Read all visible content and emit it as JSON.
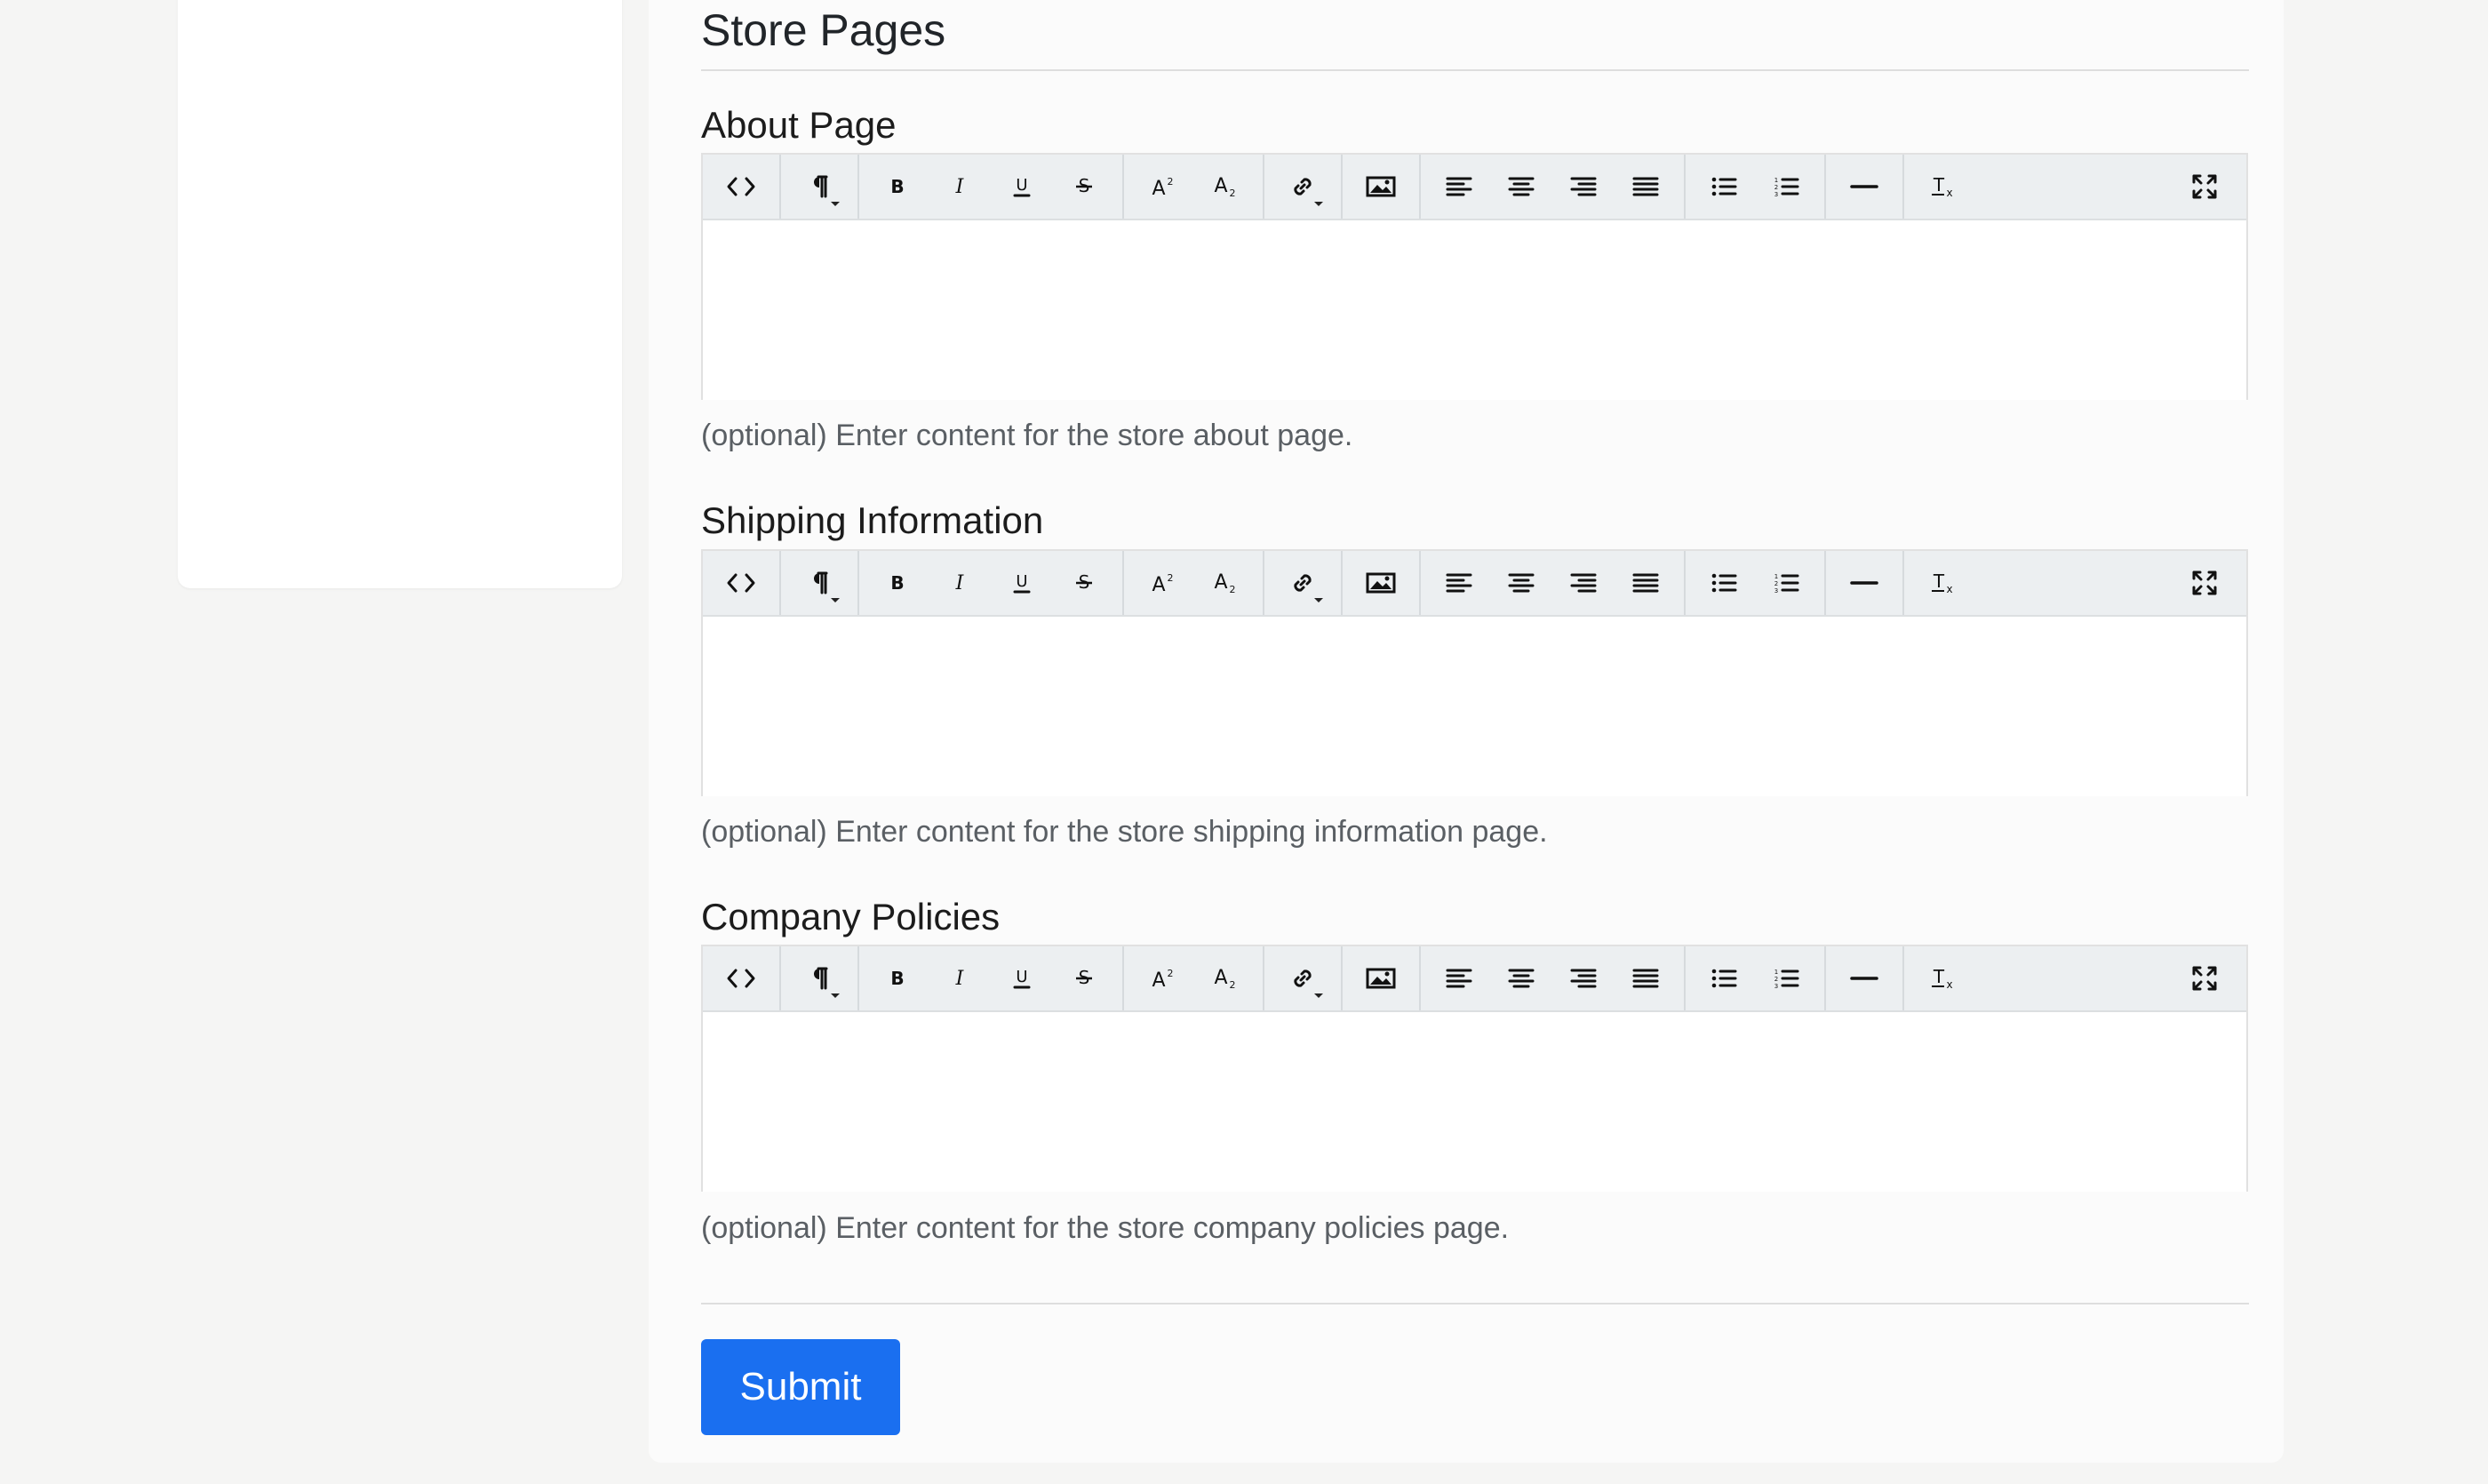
{
  "section": {
    "title": "Store Pages"
  },
  "toolbar_buttons": [
    [
      "code-view-icon"
    ],
    [
      "paragraph-icon"
    ],
    [
      "bold-icon",
      "italic-icon",
      "underline-icon",
      "strikethrough-icon"
    ],
    [
      "superscript-icon",
      "subscript-icon"
    ],
    [
      "link-icon"
    ],
    [
      "image-icon"
    ],
    [
      "align-left-icon",
      "align-center-icon",
      "align-right-icon",
      "align-justify-icon"
    ],
    [
      "bullet-list-icon",
      "numbered-list-icon"
    ],
    [
      "horizontal-rule-icon"
    ],
    [
      "clear-format-icon"
    ],
    [
      "fullscreen-icon"
    ]
  ],
  "fields": [
    {
      "label": "About Page",
      "value": "",
      "help": "(optional) Enter content for the store about page."
    },
    {
      "label": "Shipping Information",
      "value": "",
      "help": "(optional) Enter content for the store shipping information page."
    },
    {
      "label": "Company Policies",
      "value": "",
      "help": "(optional) Enter content for the store company policies page."
    }
  ],
  "submit": {
    "label": "Submit"
  },
  "colors": {
    "page_background": "#f5f5f4",
    "card_background": "#fbfbfb",
    "toolbar_background": "#eceff1",
    "submit_background": "#1a6ff0",
    "help_text": "#5a5f64"
  }
}
